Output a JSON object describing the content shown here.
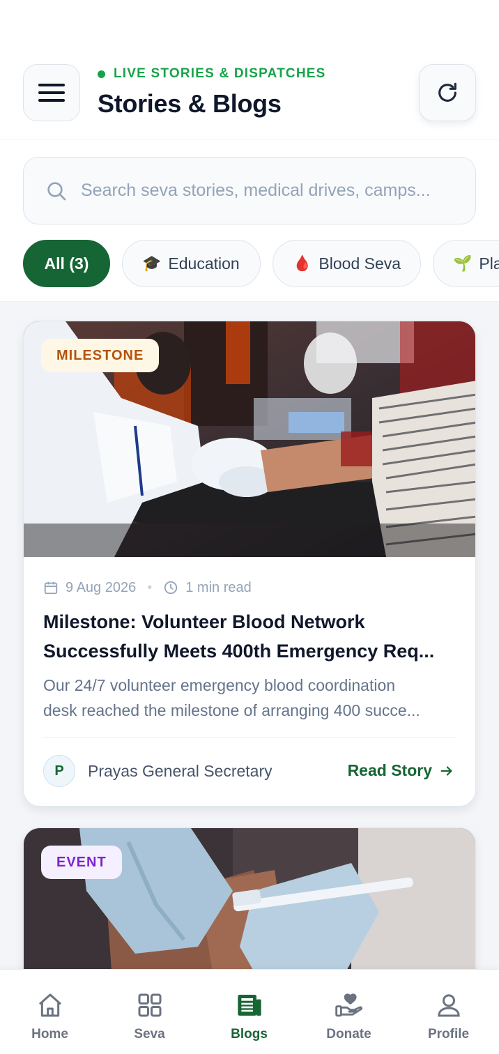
{
  "header": {
    "live_label": "LIVE STORIES & DISPATCHES",
    "title": "Stories & Blogs"
  },
  "search": {
    "placeholder": "Search seva stories, medical drives, camps..."
  },
  "filters": [
    {
      "label": "All (3)",
      "active": true,
      "icon": ""
    },
    {
      "label": "Education",
      "active": false,
      "icon": "🎓"
    },
    {
      "label": "Blood Seva",
      "active": false,
      "icon": "🩸"
    },
    {
      "label": "Pla",
      "active": false,
      "icon": "🌱"
    }
  ],
  "cards": [
    {
      "badge": "MILESTONE",
      "date": "9 Aug 2026",
      "read_time": "1 min read",
      "title_line1": "Milestone: Volunteer Blood Network",
      "title_line2": "Successfully Meets 400th Emergency Req...",
      "excerpt_line1": "Our 24/7 volunteer emergency blood coordination",
      "excerpt_line2": "desk reached the milestone of arranging 400 succe...",
      "author_initial": "P",
      "author": "Prayas General Secretary",
      "cta": "Read Story"
    },
    {
      "badge": "EVENT"
    }
  ],
  "nav": [
    {
      "label": "Home",
      "icon": "home-icon",
      "active": false
    },
    {
      "label": "Seva",
      "icon": "grid-icon",
      "active": false
    },
    {
      "label": "Blogs",
      "icon": "newspaper-icon",
      "active": true
    },
    {
      "label": "Donate",
      "icon": "donate-hand-heart-icon",
      "active": false
    },
    {
      "label": "Profile",
      "icon": "user-icon",
      "active": false
    }
  ],
  "colors": {
    "brand_green": "#166534",
    "live_green": "#16a34a",
    "milestone_badge": "#b45309",
    "event_badge": "#7e22ce"
  }
}
